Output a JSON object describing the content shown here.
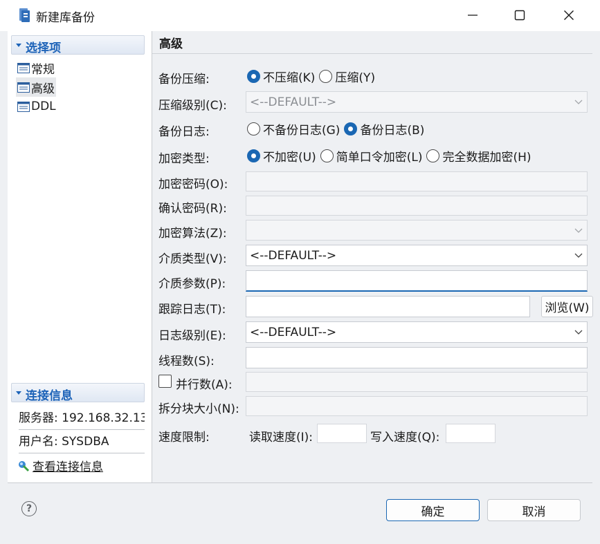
{
  "window": {
    "title": "新建库备份"
  },
  "left": {
    "options_header": "选择项",
    "nav_items": [
      {
        "label": "常规"
      },
      {
        "label": "高级"
      },
      {
        "label": "DDL"
      }
    ],
    "selected_item": "高级",
    "connection_header": "连接信息",
    "server_row": "服务器: 192.168.32.13",
    "user_row": "用户名: SYSDBA",
    "view_link": "查看连接信息"
  },
  "right": {
    "title": "高级",
    "compress": {
      "label": "备份压缩:",
      "options": [
        "不压缩(K)",
        "压缩(Y)"
      ],
      "selected": "不压缩(K)"
    },
    "compress_level": {
      "label": "压缩级别(C):",
      "value": "<--DEFAULT-->"
    },
    "backup_log": {
      "label": "备份日志:",
      "options": [
        "不备份日志(G)",
        "备份日志(B)"
      ],
      "selected": "备份日志(B)"
    },
    "encrypt_type": {
      "label": "加密类型:",
      "options": [
        "不加密(U)",
        "简单口令加密(L)",
        "完全数据加密(H)"
      ],
      "selected": "不加密(U)"
    },
    "encrypt_password": {
      "label": "加密密码(O):",
      "value": ""
    },
    "confirm_password": {
      "label": "确认密码(R):",
      "value": ""
    },
    "encrypt_algorithm": {
      "label": "加密算法(Z):",
      "value": ""
    },
    "media_type": {
      "label": "介质类型(V):",
      "value": "<--DEFAULT-->"
    },
    "media_params": {
      "label": "介质参数(P):",
      "value": ""
    },
    "trace_log": {
      "label": "跟踪日志(T):",
      "value": "",
      "browse": "浏览(W)"
    },
    "log_level": {
      "label": "日志级别(E):",
      "value": "<--DEFAULT-->"
    },
    "threads": {
      "label": "线程数(S):",
      "value": ""
    },
    "parallel": {
      "label": "并行数(A):",
      "checked": false,
      "value": ""
    },
    "split_size": {
      "label": "拆分块大小(N):",
      "value": ""
    },
    "speed_limit": {
      "label": "速度限制:",
      "read_label": "读取速度(I):",
      "read_value": "",
      "write_label": "写入速度(Q):",
      "write_value": ""
    }
  },
  "footer": {
    "help": "?",
    "ok": "确定",
    "cancel": "取消"
  },
  "colors": {
    "accent": "#1a67b3",
    "section_header_text": "#1d63b8",
    "window_bg": "#eef0f3"
  }
}
